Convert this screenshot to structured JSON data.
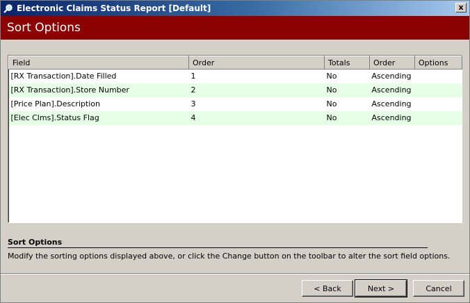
{
  "window": {
    "title": "Electronic Claims Status Report [Default]",
    "close_label": "x"
  },
  "banner": {
    "title": "Sort Options"
  },
  "grid": {
    "columns": [
      "Field",
      "Order",
      "Totals",
      "Order",
      "Options"
    ],
    "rows": [
      {
        "field": "[RX Transaction].Date Filled",
        "order": "1",
        "totals": "No",
        "direction": "Ascending",
        "options": ""
      },
      {
        "field": "[RX Transaction].Store Number",
        "order": "2",
        "totals": "No",
        "direction": "Ascending",
        "options": ""
      },
      {
        "field": "[Price Plan].Description",
        "order": "3",
        "totals": "No",
        "direction": "Ascending",
        "options": ""
      },
      {
        "field": "[Elec Clms].Status Flag",
        "order": "4",
        "totals": "No",
        "direction": "Ascending",
        "options": ""
      }
    ]
  },
  "description": {
    "title": "Sort Options",
    "text": "Modify the sorting options displayed above, or click the Change button on the toolbar to alter the sort field options."
  },
  "buttons": {
    "back": "< Back",
    "next": "Next >",
    "cancel": "Cancel"
  },
  "colors": {
    "banner": "#8b0000",
    "alt_row": "#e6ffe6",
    "titlebar": "#0a246a"
  }
}
